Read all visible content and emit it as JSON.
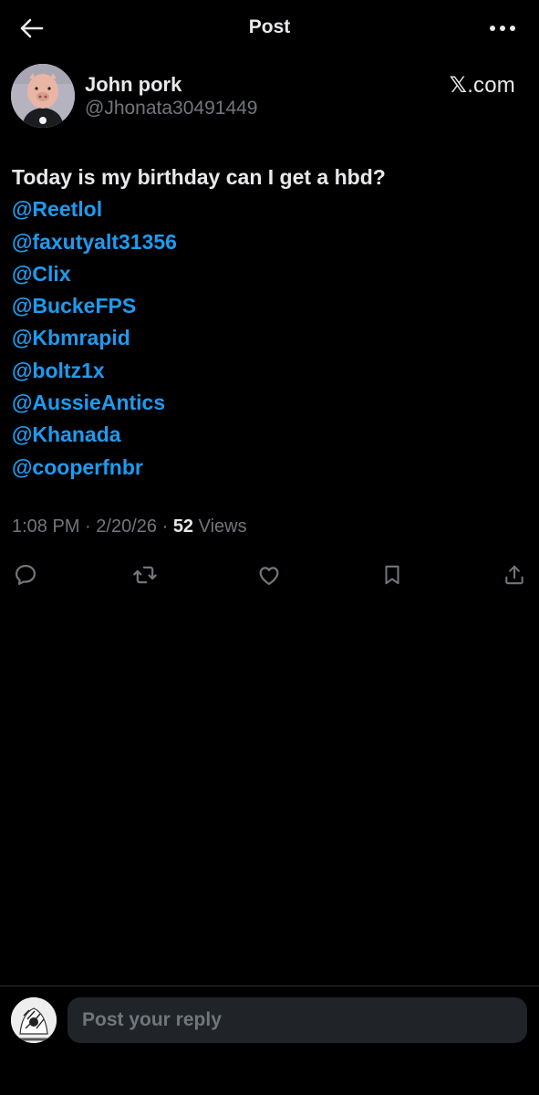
{
  "header": {
    "title": "Post",
    "back_icon": "arrow-left-icon",
    "more_icon": "more-horizontal-icon"
  },
  "author": {
    "display_name": "John pork",
    "handle": "@Jhonata30491449",
    "source_mark": "𝕏",
    "source_suffix": ".com"
  },
  "post": {
    "text": "Today is my birthday can I get a hbd?",
    "mentions": [
      "@Reetlol",
      "@faxutyalt31356",
      "@Clix",
      "@BuckeFPS",
      "@Kbmrapid",
      "@boltz1x",
      "@AussieAntics",
      "@Khanada",
      "@cooperfnbr"
    ],
    "time": "1:08 PM",
    "date": "2/20/26",
    "views_count": "52",
    "views_label": "Views",
    "separator": "·"
  },
  "actions": [
    {
      "name": "reply-icon"
    },
    {
      "name": "repost-icon"
    },
    {
      "name": "like-icon"
    },
    {
      "name": "bookmark-icon"
    },
    {
      "name": "share-icon"
    }
  ],
  "reply_bar": {
    "placeholder": "Post your reply"
  },
  "colors": {
    "background": "#000000",
    "text": "#e7e9ea",
    "muted": "#71767b",
    "link": "#1d9bf0",
    "input_bg": "#202327"
  }
}
